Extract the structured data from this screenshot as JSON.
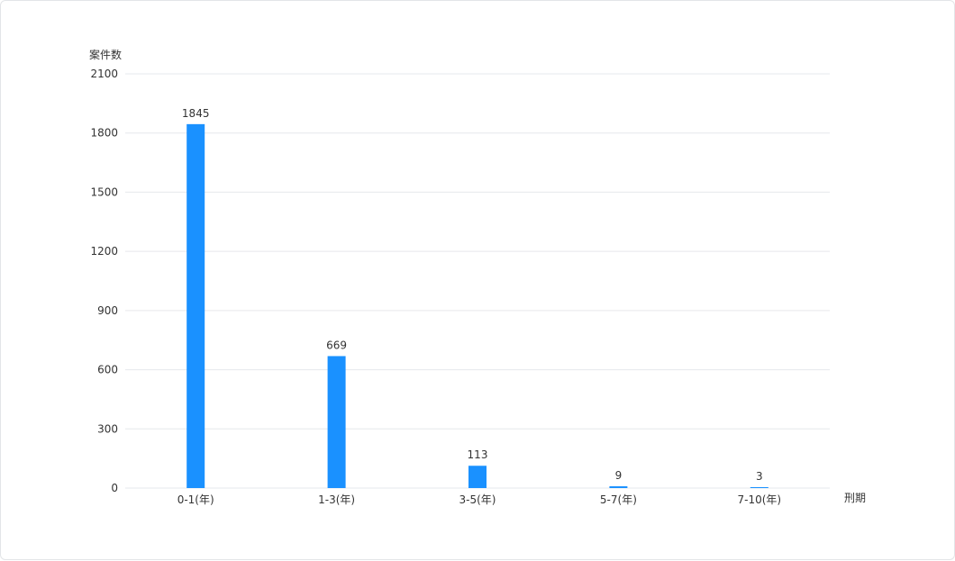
{
  "chart_data": {
    "type": "bar",
    "ylabel": "案件数",
    "xlabel": "刑期",
    "categories": [
      "0-1(年)",
      "1-3(年)",
      "3-5(年)",
      "5-7(年)",
      "7-10(年)"
    ],
    "values": [
      1845,
      669,
      113,
      9,
      3
    ],
    "ylim": [
      0,
      2100
    ],
    "yticks": [
      0,
      300,
      600,
      900,
      1200,
      1500,
      1800,
      2100
    ],
    "grid": true,
    "bar_color": "#1a91ff",
    "grid_color": "#e6e8ec"
  }
}
